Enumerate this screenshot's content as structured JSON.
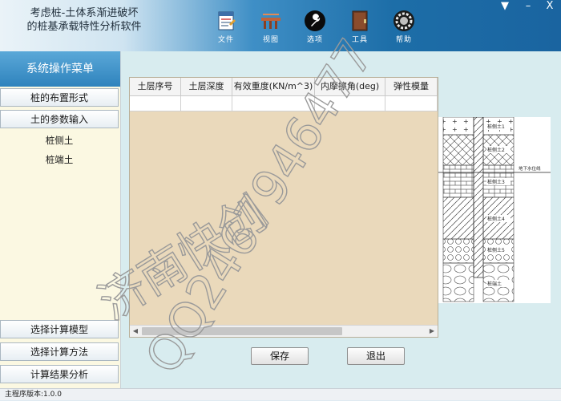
{
  "app": {
    "title_line1": "考虑桩-土体系渐进破坏",
    "title_line2": "的桩基承载特性分析软件"
  },
  "toolbar": [
    {
      "label": "文件",
      "icon": "file-icon"
    },
    {
      "label": "视图",
      "icon": "view-icon"
    },
    {
      "label": "选项",
      "icon": "wrench-icon"
    },
    {
      "label": "工具",
      "icon": "book-icon"
    },
    {
      "label": "帮助",
      "icon": "help-gear-icon"
    }
  ],
  "window_controls": {
    "menu": "▼",
    "minimize": "–",
    "close": "X"
  },
  "sidebar": {
    "title": "系统操作菜单",
    "top_buttons": [
      "桩的布置形式",
      "土的参数输入"
    ],
    "sub_items": [
      "桩侧土",
      "桩端土"
    ],
    "bottom_buttons": [
      "选择计算模型",
      "选择计算方法",
      "计算结果分析"
    ]
  },
  "grid": {
    "columns": [
      "土层序号",
      "土层深度",
      "有效重度(KN/m^3)",
      "内摩擦角(deg)",
      "弹性模量"
    ]
  },
  "diagram": {
    "layer_labels": [
      "桩侧土1",
      "桩侧土2",
      "桩侧土3",
      "桩侧土4",
      "桩侧土5",
      "桩端土"
    ],
    "water_label": "地下水位线"
  },
  "buttons": {
    "save": "保存",
    "exit": "退出"
  },
  "status": {
    "version": "主程序版本:1.0.0"
  },
  "watermark": {
    "text1": "济南快创",
    "text2": "QQ2467946477"
  },
  "colors": {
    "accent": "#1d6ea8",
    "panel": "#fbf8e2",
    "grid_bg": "#ead9bb"
  }
}
